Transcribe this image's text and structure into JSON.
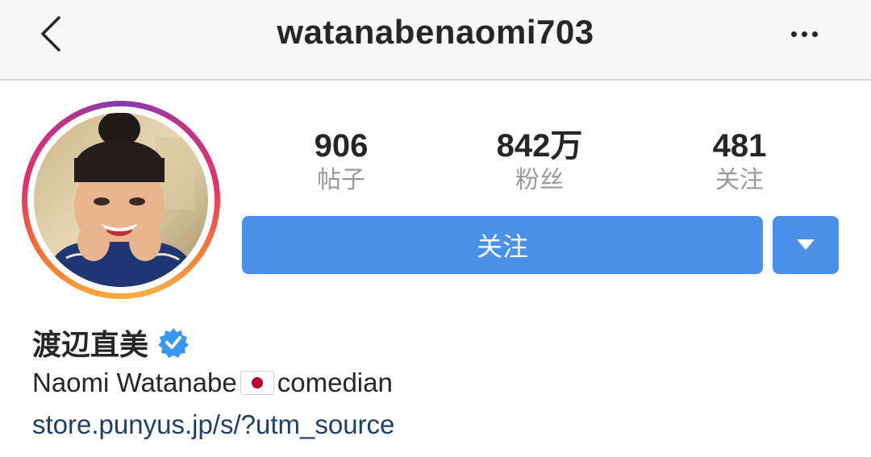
{
  "header": {
    "username": "watanabenaomi703",
    "back_icon": "chevron-left-icon",
    "more_icon": "more-horizontal-icon"
  },
  "stats": [
    {
      "value": "906",
      "label": "帖子"
    },
    {
      "value": "842万",
      "label": "粉丝"
    },
    {
      "value": "481",
      "label": "关注"
    }
  ],
  "actions": {
    "follow_label": "关注",
    "dropdown_icon": "caret-down-icon"
  },
  "profile": {
    "display_name": "渡辺直美",
    "verified_icon": "verified-badge-icon",
    "bio_name": "Naomi Watanabe",
    "bio_flag": "japan-flag-emoji",
    "bio_role": "comedian",
    "link": "store.punyus.jp/s/?utm_source"
  },
  "colors": {
    "accent": "#4a90e8",
    "verified": "#3897f0",
    "link": "#1f3f66",
    "muted": "#9a9a9a",
    "flag_red": "#bc002d"
  }
}
